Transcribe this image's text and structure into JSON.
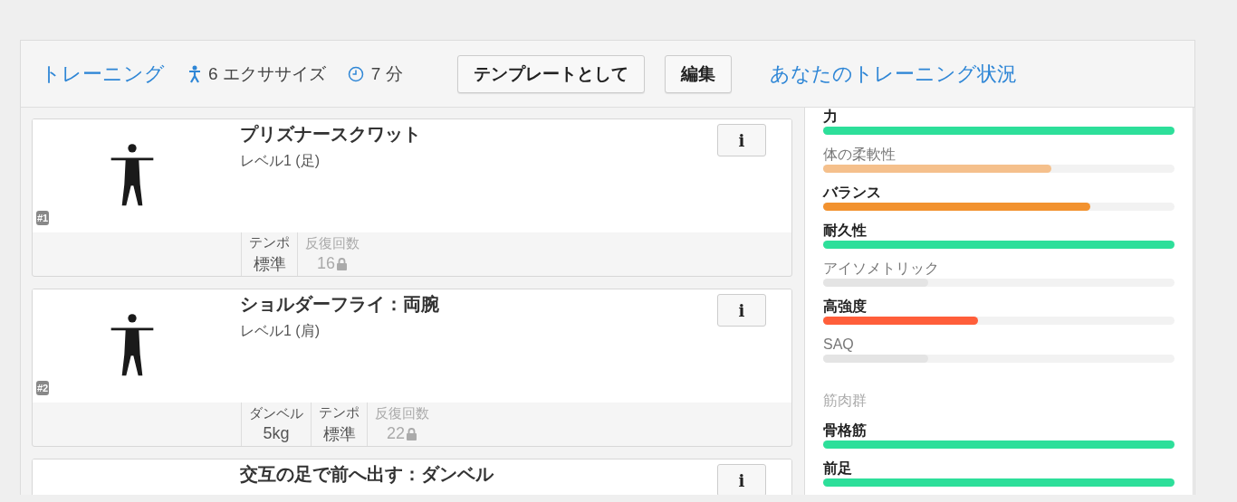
{
  "header": {
    "title": "トレーニング",
    "exercise_count": "6 エクササイズ",
    "duration": "7 分",
    "buttons": [
      "テンプレートとして",
      "編集"
    ],
    "status_link": "あなたのトレーニング状況"
  },
  "exercises": [
    {
      "badge": "#1",
      "name": "プリズナースクワット",
      "level": "レベル1 (足)",
      "info": "i",
      "stats": [
        {
          "label": "テンポ",
          "value": "標準",
          "locked": false
        },
        {
          "label": "反復回数",
          "value": "16",
          "locked": true
        }
      ]
    },
    {
      "badge": "#2",
      "name": "ショルダーフライ：両腕",
      "level": "レベル1 (肩)",
      "info": "i",
      "stats": [
        {
          "label": "ダンベル",
          "value": "5kg",
          "locked": false
        },
        {
          "label": "テンポ",
          "value": "標準",
          "locked": false
        },
        {
          "label": "反復回数",
          "value": "22",
          "locked": true
        }
      ]
    },
    {
      "name": "交互の足で前へ出す：ダンベル",
      "info": "i"
    }
  ],
  "status": {
    "attributes": [
      {
        "label": "力",
        "active": true,
        "level": 1,
        "color": "#2ddf9a"
      },
      {
        "label": "体の柔軟性",
        "active": false,
        "level": 0.65,
        "color": "#f5c08c"
      },
      {
        "label": "バランス",
        "active": true,
        "level": 0.76,
        "color": "#f2922f"
      },
      {
        "label": "耐久性",
        "active": true,
        "level": 1,
        "color": "#2ddf9a"
      },
      {
        "label": "アイソメトリック",
        "active": false,
        "level": 0.3,
        "color": "#e4e4e4"
      },
      {
        "label": "高強度",
        "active": true,
        "level": 0.44,
        "color": "#ff5e3a"
      },
      {
        "label": "SAQ",
        "active": false,
        "level": 0.3,
        "color": "#e4e4e4"
      }
    ],
    "muscle_heading": "筋肉群",
    "muscles": [
      {
        "label": "骨格筋",
        "active": true,
        "level": 1,
        "color": "#2ddf9a"
      },
      {
        "label": "前足",
        "active": true,
        "level": 1,
        "color": "#2ddf9a"
      }
    ]
  }
}
